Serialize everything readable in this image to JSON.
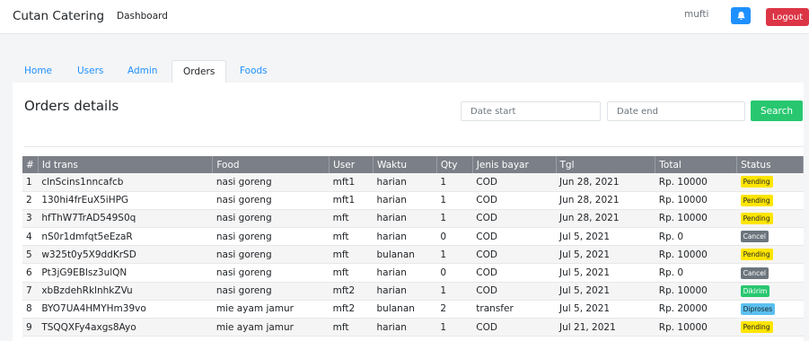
{
  "navbar": {
    "brand": "Cutan Catering",
    "dashboard_link": "Dashboard",
    "username": "mufti",
    "bell_icon": "bell-icon",
    "logout_label": "Logout"
  },
  "tabs": [
    {
      "label": "Home",
      "active": false
    },
    {
      "label": "Users",
      "active": false
    },
    {
      "label": "Admin",
      "active": false
    },
    {
      "label": "Orders",
      "active": true
    },
    {
      "label": "Foods",
      "active": false
    }
  ],
  "orders": {
    "title": "Orders details",
    "date_start_placeholder": "Date start",
    "date_end_placeholder": "Date end",
    "search_label": "Search",
    "columns": [
      "#",
      "Id trans",
      "Food",
      "User",
      "Waktu",
      "Qty",
      "Jenis bayar",
      "Tgl",
      "Total",
      "Status"
    ],
    "rows": [
      [
        "1",
        "clnScins1nncafcb",
        "nasi goreng",
        "mft1",
        "harian",
        "1",
        "COD",
        "Jun 28, 2021",
        "Rp. 10000",
        "Pending"
      ],
      [
        "2",
        "130hi4frEuX5iHPG",
        "nasi goreng",
        "mft1",
        "harian",
        "1",
        "COD",
        "Jun 28, 2021",
        "Rp. 10000",
        "Pending"
      ],
      [
        "3",
        "hfThW7TrAD549S0q",
        "nasi goreng",
        "mft",
        "harian",
        "1",
        "COD",
        "Jun 28, 2021",
        "Rp. 10000",
        "Pending"
      ],
      [
        "4",
        "nS0r1dmfqt5eEzaR",
        "nasi goreng",
        "mft",
        "harian",
        "0",
        "COD",
        "Jul 5, 2021",
        "Rp. 0",
        "Cancel"
      ],
      [
        "5",
        "w325t0y5X9ddKrSD",
        "nasi goreng",
        "mft",
        "bulanan",
        "1",
        "COD",
        "Jul 5, 2021",
        "Rp. 10000",
        "Pending"
      ],
      [
        "6",
        "Pt3jG9EBlsz3ulQN",
        "nasi goreng",
        "mft",
        "harian",
        "0",
        "COD",
        "Jul 5, 2021",
        "Rp. 0",
        "Cancel"
      ],
      [
        "7",
        "xbBzdehRklnhkZVu",
        "nasi goreng",
        "mft2",
        "harian",
        "1",
        "COD",
        "Jul 5, 2021",
        "Rp. 10000",
        "Dikirim"
      ],
      [
        "8",
        "BYO7UA4HMYHm39vo",
        "mie ayam jamur",
        "mft2",
        "bulanan",
        "2",
        "transfer",
        "Jul 5, 2021",
        "Rp. 20000",
        "Diproses"
      ],
      [
        "9",
        "TSQQXFy4axgs8Ayo",
        "mie ayam jamur",
        "mft",
        "harian",
        "1",
        "COD",
        "Jul 21, 2021",
        "Rp. 10000",
        "Pending"
      ]
    ],
    "status_colors": {
      "Pending": {
        "bg": "#ffe500",
        "fg": "#212529"
      },
      "Cancel": {
        "bg": "#6c757d",
        "fg": "#ffffff"
      },
      "Dikirim": {
        "bg": "#28c76f",
        "fg": "#ffffff"
      },
      "Diproses": {
        "bg": "#5bc0f0",
        "fg": "#212529"
      }
    }
  }
}
